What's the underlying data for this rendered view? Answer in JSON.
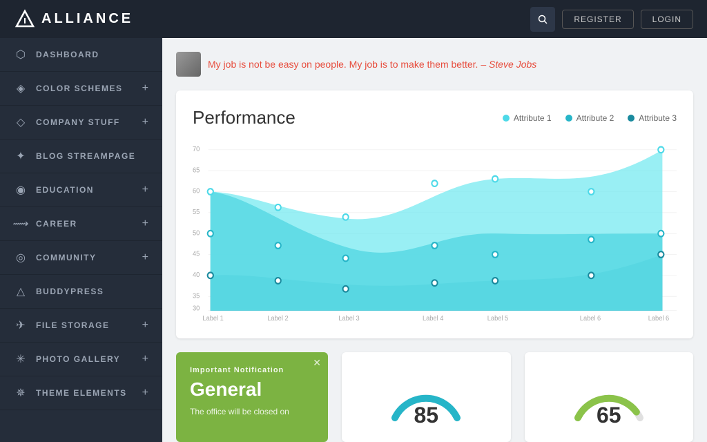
{
  "header": {
    "logo_text": "ALLIANCE",
    "search_label": "🔍",
    "register_label": "REGISTER",
    "login_label": "LOGIN"
  },
  "quote": {
    "text": "My job is not be easy on people. My job is to make them better.",
    "author": "Steve Jobs"
  },
  "sidebar": {
    "items": [
      {
        "id": "dashboard",
        "label": "DASHBOARD",
        "icon": "⬡",
        "has_plus": false
      },
      {
        "id": "color-schemes",
        "label": "COLOR SCHEMES",
        "icon": "◈",
        "has_plus": true
      },
      {
        "id": "company-stuff",
        "label": "COMPANY STUFF",
        "icon": "◇",
        "has_plus": true
      },
      {
        "id": "blog-streampage",
        "label": "BLOG STREAMPAGE",
        "icon": "✦",
        "has_plus": false
      },
      {
        "id": "education",
        "label": "EDUCATION",
        "icon": "◉",
        "has_plus": true
      },
      {
        "id": "career",
        "label": "CAREER",
        "icon": "⟿",
        "has_plus": true
      },
      {
        "id": "community",
        "label": "COMMUNITY",
        "icon": "◎",
        "has_plus": true
      },
      {
        "id": "buddypress",
        "label": "BUDDYPRESS",
        "icon": "△",
        "has_plus": false
      },
      {
        "id": "file-storage",
        "label": "FILE STORAGE",
        "icon": "✈",
        "has_plus": true
      },
      {
        "id": "photo-gallery",
        "label": "PHOTO GALLERY",
        "icon": "✳",
        "has_plus": true
      },
      {
        "id": "theme-elements",
        "label": "THEME ELEMENTS",
        "icon": "✵",
        "has_plus": true
      }
    ]
  },
  "performance_chart": {
    "title": "Performance",
    "legend": [
      {
        "label": "Attribute 1",
        "color": "#4dd9e8"
      },
      {
        "label": "Attribute 2",
        "color": "#26b5c8"
      },
      {
        "label": "Attribute 3",
        "color": "#1a8a9e"
      }
    ],
    "y_labels": [
      "70",
      "65",
      "60",
      "55",
      "50",
      "45",
      "40",
      "35",
      "30"
    ],
    "x_labels": [
      "Label 1",
      "Label 2",
      "Label 3",
      "Label 4",
      "Label 5",
      "Label 6",
      "Label 6"
    ],
    "colors": {
      "area1": "#6de8f0",
      "area2": "#2ab8cc",
      "area3": "#1a8a9e"
    }
  },
  "notification": {
    "label": "Important Notification",
    "title": "General",
    "body": "The office will be closed on",
    "bg_color": "#7cb342"
  },
  "gauge1": {
    "value": "85",
    "color": "#26b5c8"
  },
  "gauge2": {
    "value": "65",
    "color": "#8bc34a"
  }
}
